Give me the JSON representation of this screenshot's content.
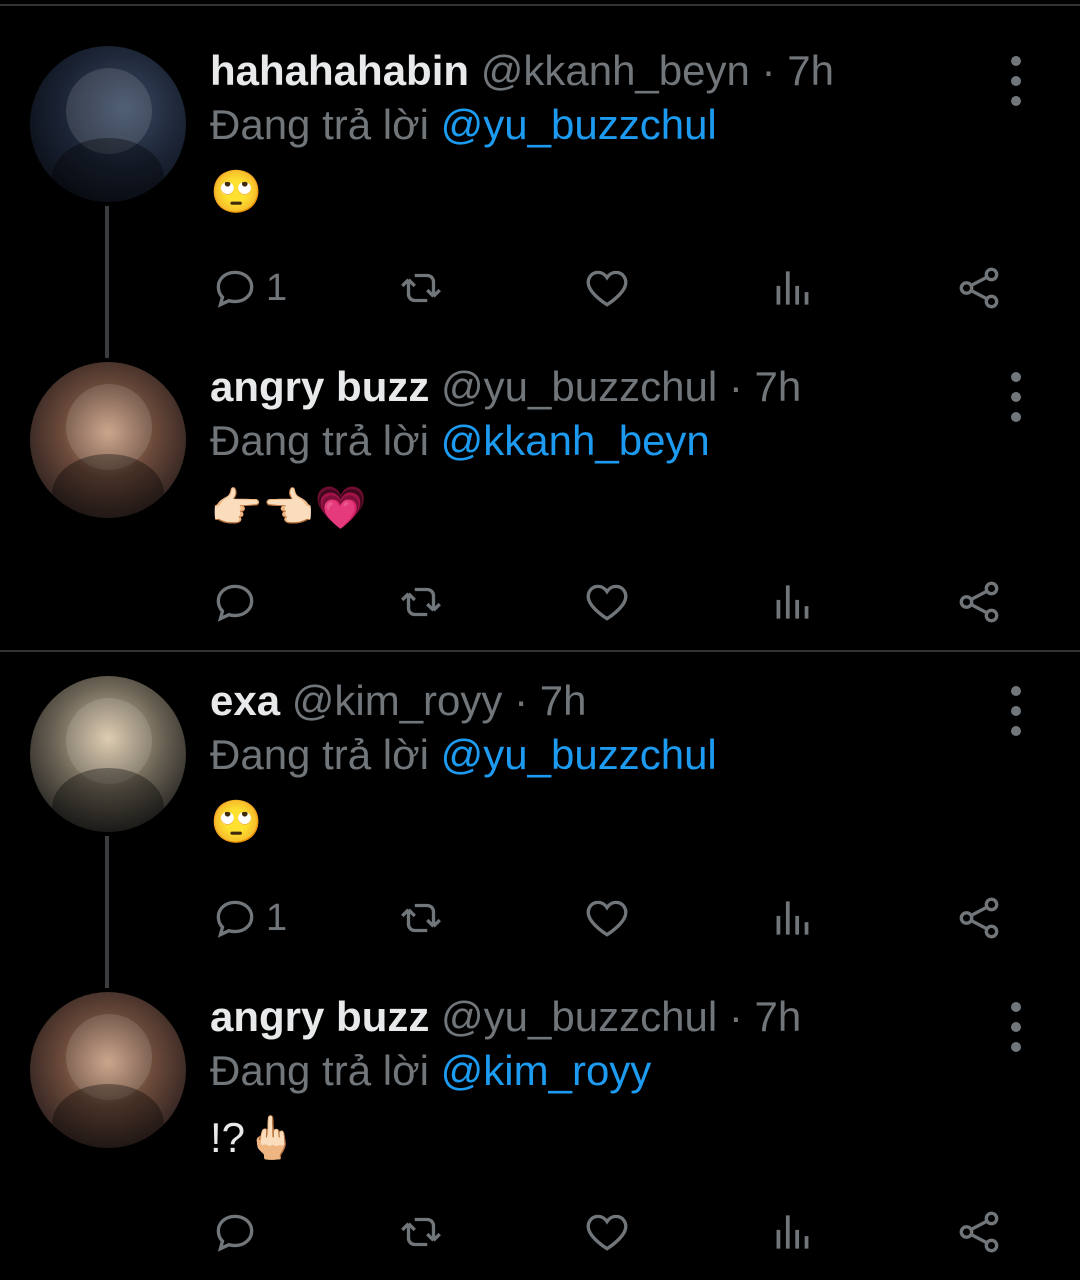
{
  "separators": [
    "top",
    "mid"
  ],
  "tweets": [
    {
      "name": "hahahahabin",
      "handle": "@kkanh_beyn",
      "dot": "·",
      "time": "7h",
      "reply_prefix": "Đang trả lời",
      "reply_to": "@yu_buzzchul",
      "body": "🙄",
      "reply_count": "1",
      "avatar_icon": "avatar-photo"
    },
    {
      "name": "angry buzz",
      "handle": "@yu_buzzchul",
      "dot": "·",
      "time": "7h",
      "reply_prefix": "Đang trả lời",
      "reply_to": "@kkanh_beyn",
      "body": "👉🏻👈🏻💗",
      "reply_count": "",
      "avatar_icon": "avatar-photo"
    },
    {
      "name": "exa",
      "handle": "@kim_royy",
      "dot": "·",
      "time": "7h",
      "reply_prefix": "Đang trả lời",
      "reply_to": "@yu_buzzchul",
      "body": "🙄",
      "reply_count": "1",
      "avatar_icon": "avatar-photo"
    },
    {
      "name": "angry buzz",
      "handle": "@yu_buzzchul",
      "dot": "·",
      "time": "7h",
      "reply_prefix": "Đang trả lời",
      "reply_to": "@kim_royy",
      "body": "!?🖕🏻",
      "reply_count": "",
      "avatar_icon": "avatar-photo"
    }
  ],
  "icons": {
    "reply": "comment-icon",
    "retweet": "retweet-icon",
    "like": "heart-icon",
    "views": "analytics-icon",
    "share": "share-icon",
    "more": "more-vertical-icon"
  },
  "colors": {
    "background": "#000000",
    "mention": "#1d9bf0",
    "muted": "#71767b",
    "text": "#e7e9ea"
  }
}
